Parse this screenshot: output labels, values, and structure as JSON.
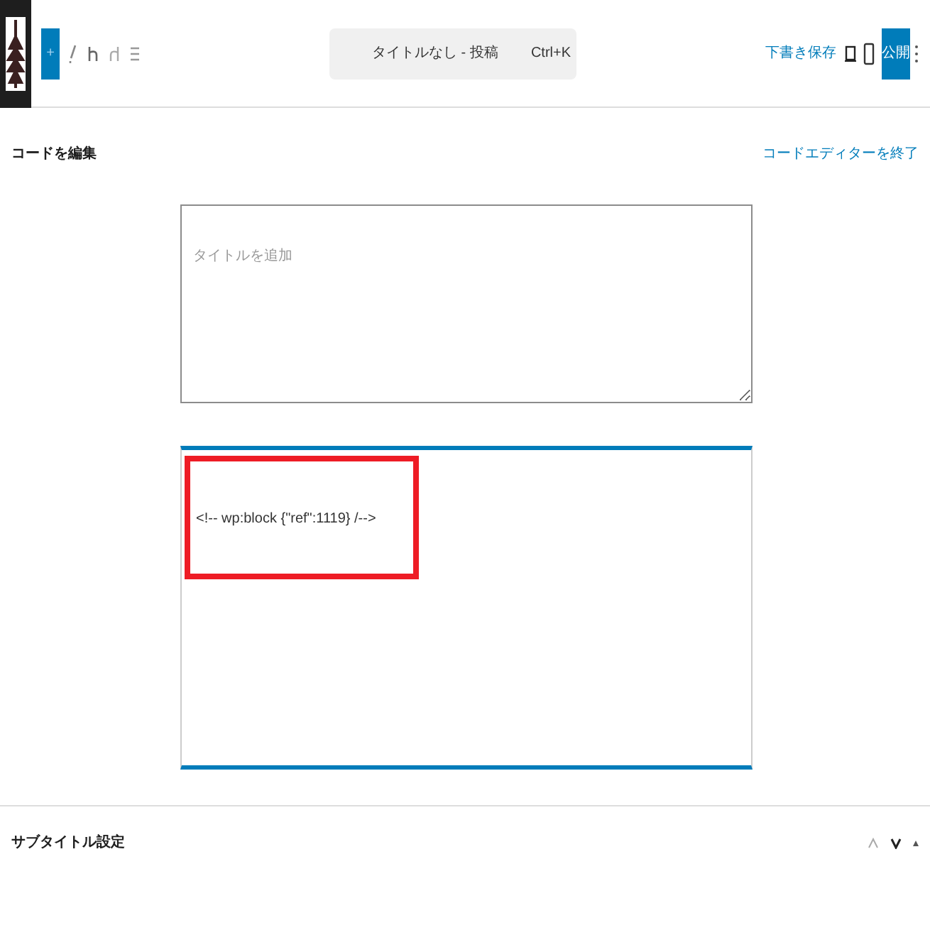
{
  "toolbar": {
    "add_button": "+",
    "search": {
      "label": "タイトルなし - 投稿",
      "shortcut": "Ctrl+K"
    },
    "save_draft": "下書き保存",
    "publish": "公開"
  },
  "code_editor": {
    "heading": "コードを編集",
    "exit_link": "コードエディターを終了",
    "title_field": {
      "placeholder": "タイトルを追加"
    },
    "code": "<!-- wp:block {\"ref\":1119} /-->"
  },
  "panel": {
    "title": "サブタイトル設定",
    "expanded": true
  }
}
